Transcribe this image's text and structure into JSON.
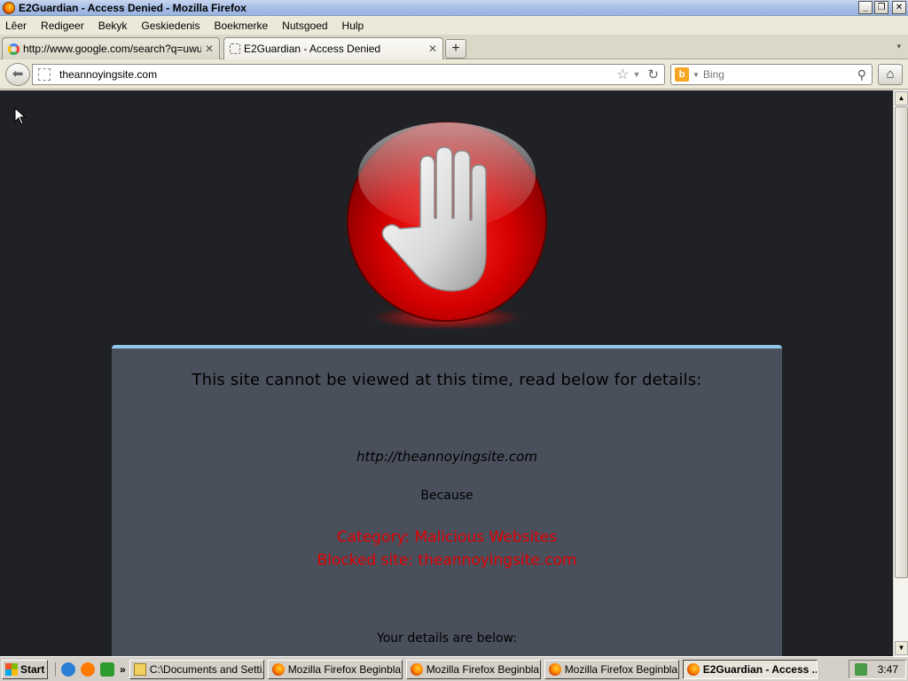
{
  "window": {
    "title": "E2Guardian - Access Denied - Mozilla Firefox",
    "minimize": "_",
    "restore": "❐",
    "close": "✕"
  },
  "menu": [
    "Lêer",
    "Redigeer",
    "Bekyk",
    "Geskiedenis",
    "Boekmerke",
    "Nutsgoed",
    "Hulp"
  ],
  "tabs": [
    {
      "label": "http://www.google.com/search?q=uwu&...",
      "close": "✕"
    },
    {
      "label": "E2Guardian - Access Denied",
      "close": "✕"
    }
  ],
  "new_tab": "+",
  "nav": {
    "url": "theannoyingsite.com",
    "search_placeholder": "Bing"
  },
  "page": {
    "heading": "This site cannot be viewed at this time, read below for details:",
    "blocked_url": "http://theannoyingsite.com",
    "because": "Because",
    "category": "Category: Malicious Websites",
    "blocked_site": "Blocked site: theannoyingsite.com",
    "details": "Your details are below:"
  },
  "taskbar": {
    "start": "Start",
    "more": "»",
    "tasks": [
      {
        "label": "C:\\Documents and Setti...",
        "icon": "folder-icon",
        "active": false
      },
      {
        "label": "Mozilla Firefox Beginbla...",
        "icon": "firefox-icon",
        "active": false
      },
      {
        "label": "Mozilla Firefox Beginbla...",
        "icon": "firefox-icon",
        "active": false
      },
      {
        "label": "Mozilla Firefox Beginbla...",
        "icon": "firefox-icon",
        "active": false
      },
      {
        "label": "E2Guardian - Access ...",
        "icon": "firefox-icon",
        "active": true
      }
    ],
    "clock": "3:47"
  },
  "colors": {
    "page_bg": "#202124",
    "panel_bg": "#4a4f5c",
    "panel_border": "#8fc7ea",
    "alert_red": "#e00000"
  }
}
